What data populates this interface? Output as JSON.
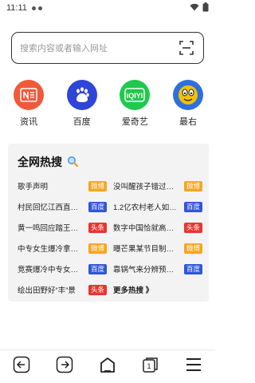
{
  "status": {
    "time": "11:11"
  },
  "search": {
    "placeholder": "搜索内容或者输入网址"
  },
  "shortcuts": [
    {
      "label": "资讯",
      "color": "#f05a3a"
    },
    {
      "label": "百度",
      "color": "#2e45d8"
    },
    {
      "label": "爱奇艺",
      "color": "#1ec94b"
    },
    {
      "label": "最右",
      "color": "#f2c200"
    }
  ],
  "hot": {
    "title": "全网热搜",
    "items": [
      {
        "text": "歌手声明",
        "badge": "微博"
      },
      {
        "text": "没叫醒孩子错过…",
        "badge": "微博"
      },
      {
        "text": "村民回忆江西直…",
        "badge": "百度"
      },
      {
        "text": "1.2亿农村老人如…",
        "badge": "百度"
      },
      {
        "text": "黄一鸣回应踏王…",
        "badge": "头条"
      },
      {
        "text": "数字中国恰就高…",
        "badge": "头条"
      },
      {
        "text": "中专女生爆冷拿…",
        "badge": "微博"
      },
      {
        "text": "曝芒果某节目制…",
        "badge": "微博"
      },
      {
        "text": "竞赛爆冷中专女…",
        "badge": "百度"
      },
      {
        "text": "靠锅气来分辨预…",
        "badge": "百度"
      },
      {
        "text": "绘出田野好“丰”景",
        "badge": "头条"
      }
    ],
    "more": "更多热搜 》"
  }
}
